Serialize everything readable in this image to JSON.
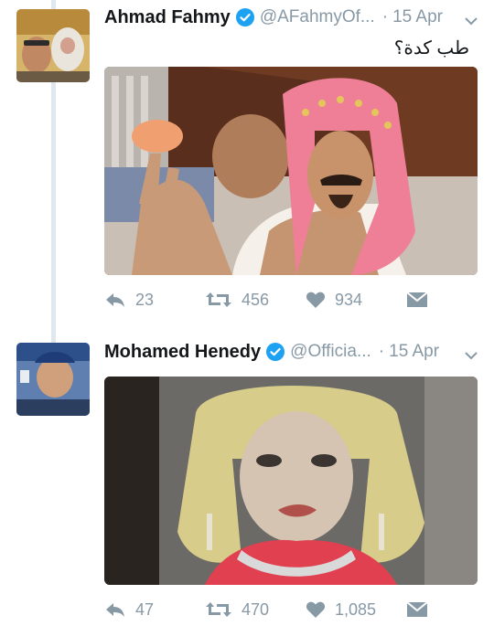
{
  "tweets": [
    {
      "name": "Ahmad Fahmy",
      "handle": "@AFahmyOf...",
      "time": "15 Apr",
      "dot": "·",
      "text": "طب كدة؟",
      "actions": {
        "replies": "23",
        "retweets": "456",
        "likes": "934"
      }
    },
    {
      "name": "Mohamed Henedy",
      "handle": "@Officia...",
      "time": "15 Apr",
      "dot": "·",
      "text": "",
      "actions": {
        "replies": "47",
        "retweets": "470",
        "likes": "1,085"
      }
    }
  ],
  "colors": {
    "verified": "#1da1f2",
    "muted": "#8899a6",
    "thread_line": "#e1e8ed"
  },
  "icons": [
    "reply-icon",
    "retweet-icon",
    "like-icon",
    "direct-message-icon",
    "verified-icon",
    "caret-down-icon"
  ]
}
